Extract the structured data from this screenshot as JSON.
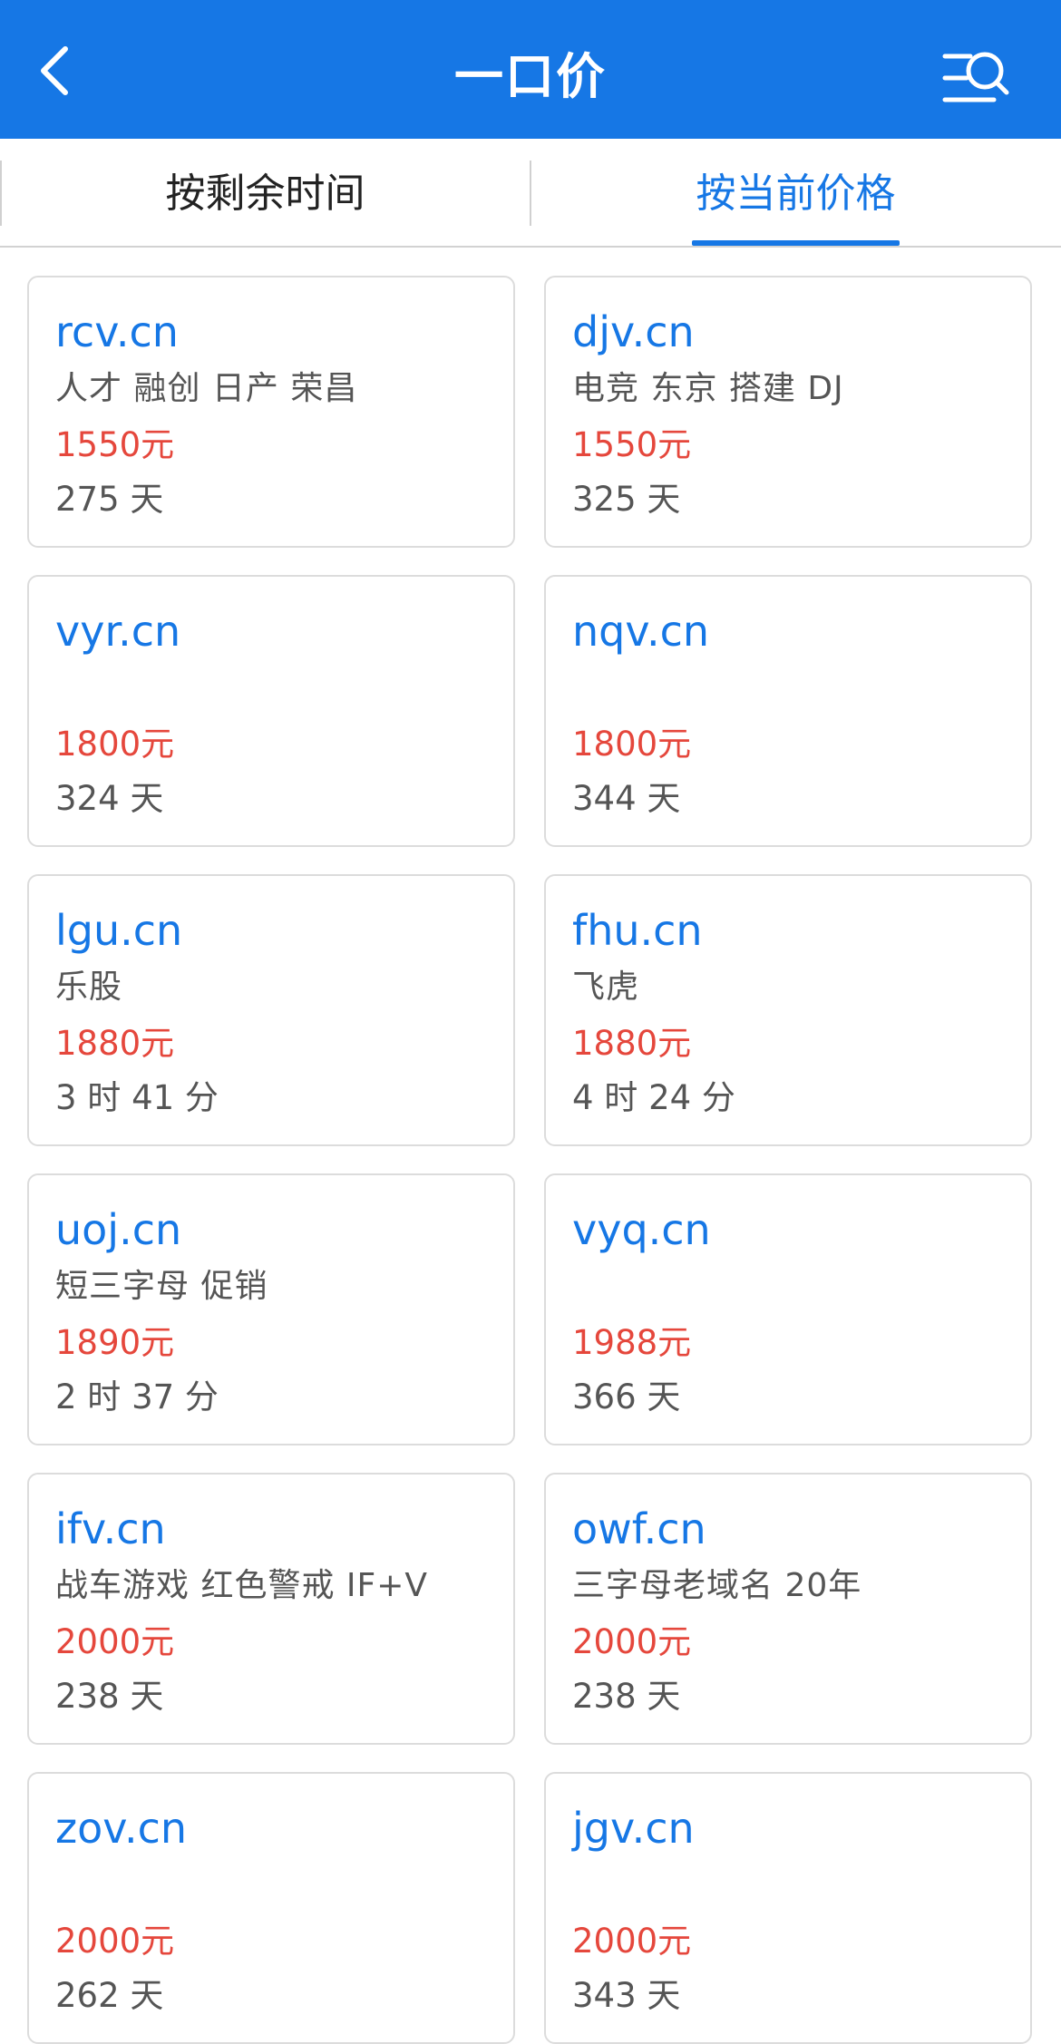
{
  "header": {
    "title": "一口价",
    "background": "#1677e5",
    "back_icon": "chevron-left-icon",
    "filter_icon": "search-filter-icon"
  },
  "tabs": [
    {
      "label": "按剩余时间",
      "active": false
    },
    {
      "label": "按当前价格",
      "active": true
    }
  ],
  "colors": {
    "domain": "#1677e5",
    "price": "#e5473c",
    "text": "#555555"
  },
  "listings": [
    {
      "domain": "rcv.cn",
      "tags": "人才  融创 日产  荣昌",
      "price": "1550元",
      "remaining": "275 天"
    },
    {
      "domain": "djv.cn",
      "tags": "电竞 东京 搭建  DJ",
      "price": "1550元",
      "remaining": "325 天"
    },
    {
      "domain": "vyr.cn",
      "tags": "",
      "price": "1800元",
      "remaining": "324 天"
    },
    {
      "domain": "nqv.cn",
      "tags": "",
      "price": "1800元",
      "remaining": "344 天"
    },
    {
      "domain": "lgu.cn",
      "tags": "乐股",
      "price": "1880元",
      "remaining": "3 时 41 分"
    },
    {
      "domain": "fhu.cn",
      "tags": "飞虎",
      "price": "1880元",
      "remaining": "4 时 24 分"
    },
    {
      "domain": "uoj.cn",
      "tags": "短三字母 促销",
      "price": "1890元",
      "remaining": "2 时 37 分"
    },
    {
      "domain": "vyq.cn",
      "tags": "",
      "price": "1988元",
      "remaining": "366 天"
    },
    {
      "domain": "ifv.cn",
      "tags": "战车游戏 红色警戒  IF+V",
      "price": "2000元",
      "remaining": "238 天"
    },
    {
      "domain": "owf.cn",
      "tags": "三字母老域名 20年",
      "price": "2000元",
      "remaining": "238 天"
    },
    {
      "domain": "zov.cn",
      "tags": "",
      "price": "2000元",
      "remaining": "262 天"
    },
    {
      "domain": "jgv.cn",
      "tags": "",
      "price": "2000元",
      "remaining": "343 天"
    }
  ]
}
